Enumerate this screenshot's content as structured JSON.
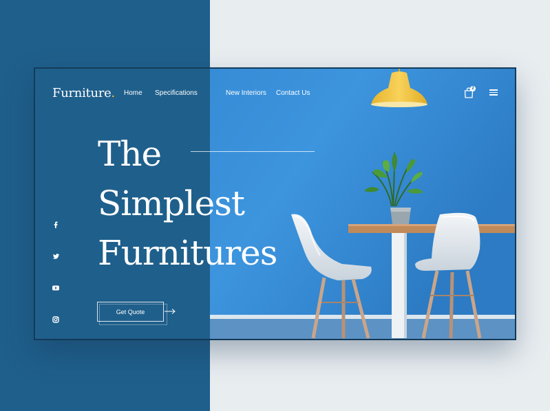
{
  "brand": {
    "name": "Furniture",
    "dot": "."
  },
  "nav": {
    "items": [
      "Home",
      "Specifications",
      "New Interiors",
      "Contact Us"
    ]
  },
  "cart": {
    "count": "2",
    "icon": "shopping-bag-icon"
  },
  "menu": {
    "icon": "hamburger-menu-icon"
  },
  "hero": {
    "lines": [
      "The",
      "Simplest",
      "Furnitures"
    ]
  },
  "cta": {
    "label": "Get Quote"
  },
  "social": [
    "facebook-icon",
    "twitter-icon",
    "youtube-icon",
    "instagram-icon"
  ],
  "colors": {
    "primary": "#1f5f8b",
    "accent": "#f2c14e",
    "wall": "#3a8fd6",
    "background": "#e8edf0"
  }
}
